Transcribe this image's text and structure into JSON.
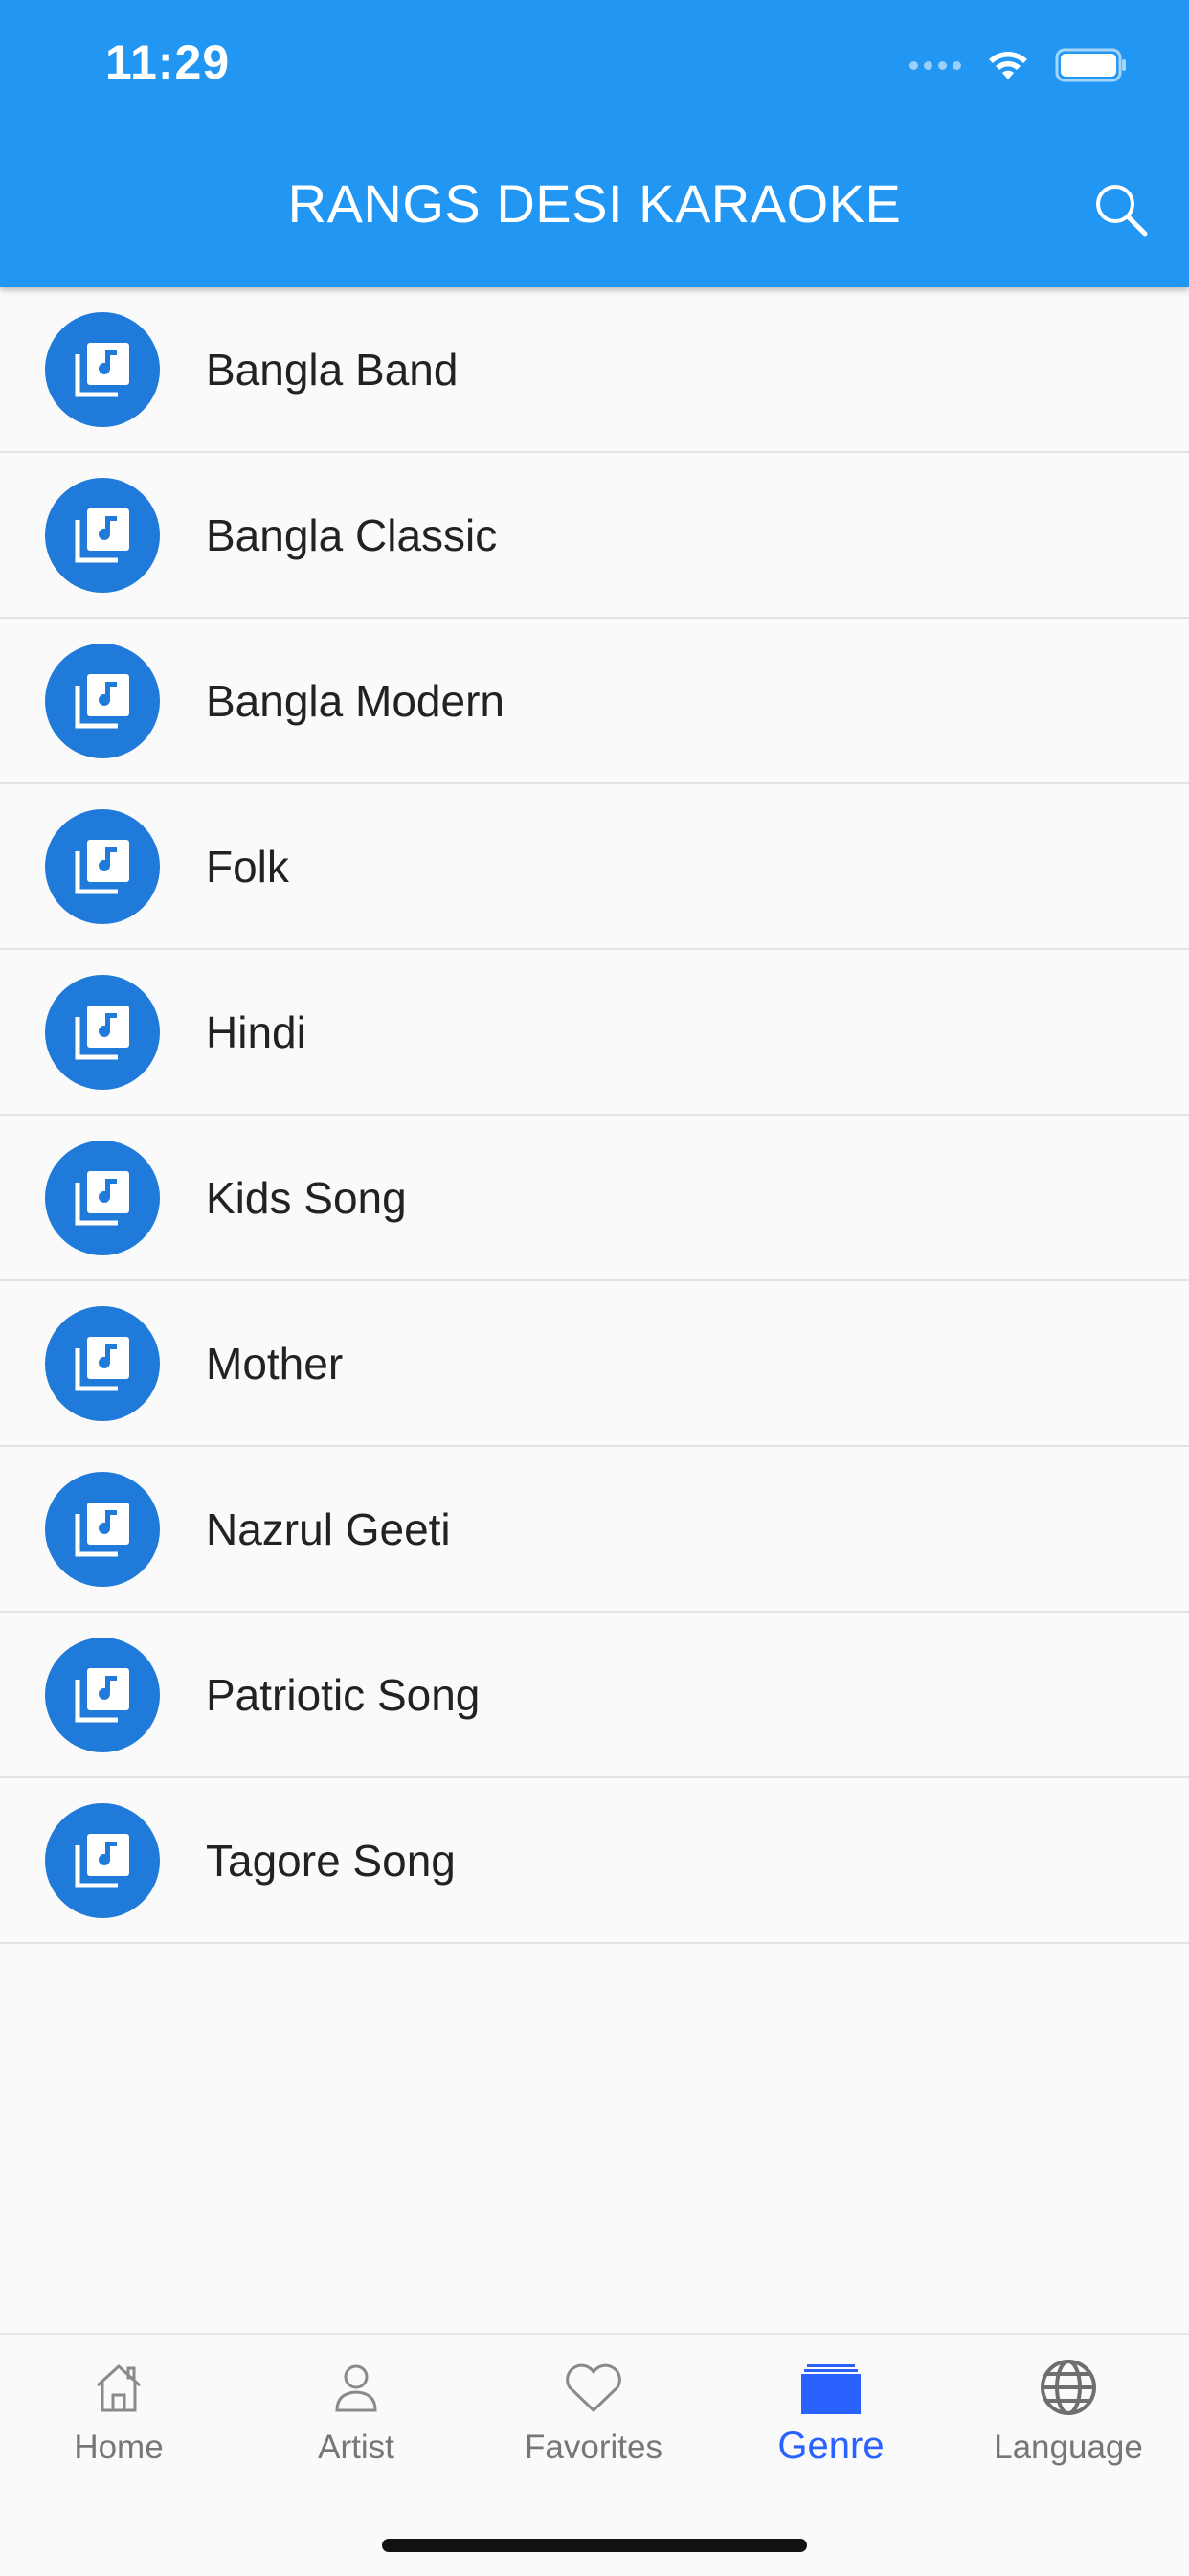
{
  "status_bar": {
    "time": "11:29",
    "icons": [
      "cellular-signal-icon",
      "wifi-icon",
      "battery-icon"
    ]
  },
  "header": {
    "title": "RANGS DESI KARAOKE",
    "search_icon": "search-icon"
  },
  "genres": [
    {
      "label": "Bangla Band",
      "icon": "music-library-icon"
    },
    {
      "label": "Bangla Classic",
      "icon": "music-library-icon"
    },
    {
      "label": "Bangla Modern",
      "icon": "music-library-icon"
    },
    {
      "label": "Folk",
      "icon": "music-library-icon"
    },
    {
      "label": "Hindi",
      "icon": "music-library-icon"
    },
    {
      "label": "Kids Song",
      "icon": "music-library-icon"
    },
    {
      "label": "Mother",
      "icon": "music-library-icon"
    },
    {
      "label": "Nazrul Geeti",
      "icon": "music-library-icon"
    },
    {
      "label": "Patriotic Song",
      "icon": "music-library-icon"
    },
    {
      "label": "Tagore Song",
      "icon": "music-library-icon"
    }
  ],
  "tabs": [
    {
      "label": "Home",
      "icon": "home-icon",
      "active": false
    },
    {
      "label": "Artist",
      "icon": "person-icon",
      "active": false
    },
    {
      "label": "Favorites",
      "icon": "heart-icon",
      "active": false
    },
    {
      "label": "Genre",
      "icon": "stack-icon",
      "active": true
    },
    {
      "label": "Language",
      "icon": "globe-icon",
      "active": false
    }
  ],
  "colors": {
    "app_bar": "#2196f3",
    "genre_icon_circle": "#1f7ad9",
    "active_tab": "#2962ff",
    "inactive_tab": "#777777",
    "background": "#fafafa"
  }
}
